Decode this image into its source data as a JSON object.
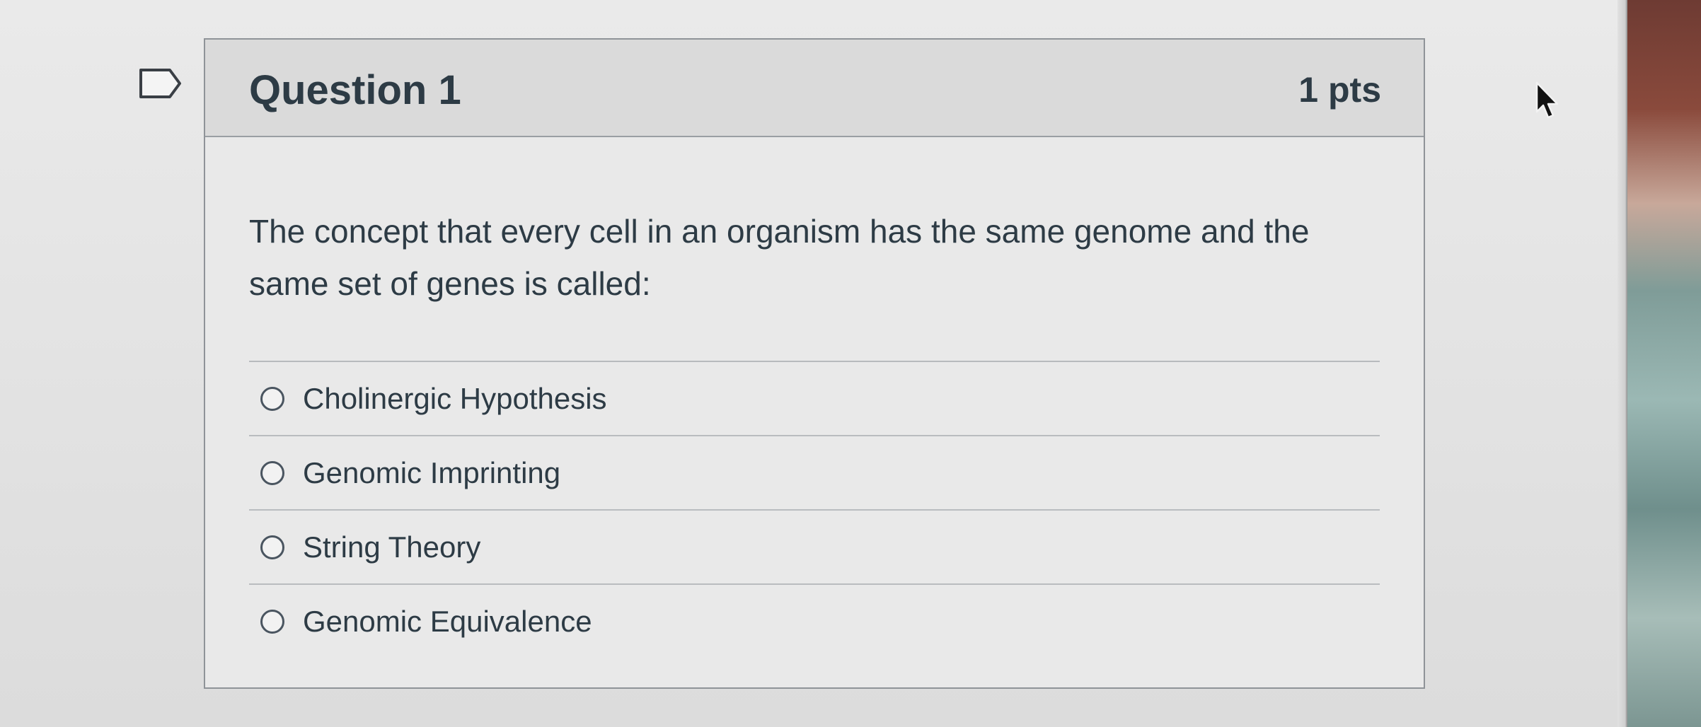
{
  "question": {
    "title": "Question 1",
    "points": "1 pts",
    "text": "The concept that every cell in an organism has the same genome and the same set of genes is called:"
  },
  "answers": [
    {
      "label": "Cholinergic Hypothesis"
    },
    {
      "label": "Genomic Imprinting"
    },
    {
      "label": "String Theory"
    },
    {
      "label": "Genomic Equivalence"
    }
  ],
  "icons": {
    "flag": "bookmark-flag-icon",
    "radio": "radio-button-icon",
    "cursor": "mouse-pointer-icon"
  },
  "colors": {
    "text": "#2d3b45",
    "header_bg": "#dadada",
    "border": "#8f9398"
  }
}
